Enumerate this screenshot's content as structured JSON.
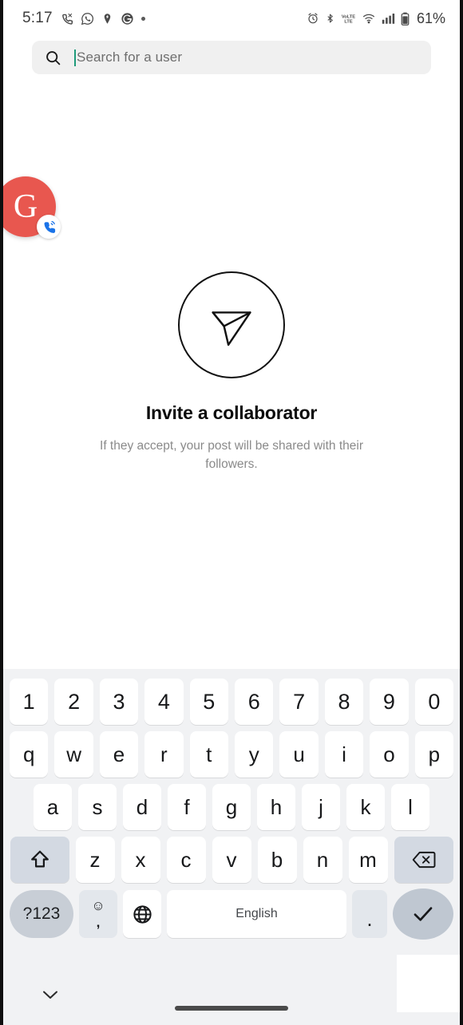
{
  "statusbar": {
    "time": "5:17",
    "left_icons": [
      "phone-call-icon",
      "whatsapp-icon",
      "location-pin-icon",
      "google-g-icon",
      "dot-icon"
    ],
    "right_icons": [
      "alarm-icon",
      "bluetooth-icon",
      "volte-icon",
      "wifi-icon",
      "signal-icon",
      "battery-icon"
    ],
    "battery_percent": "61%"
  },
  "search": {
    "placeholder": "Search for a user",
    "value": "",
    "icon": "search-icon",
    "caret_color": "#1f9b7a"
  },
  "floating_bubble": {
    "letter": "G",
    "color": "#e8574f",
    "badge_icon": "phone-call-icon"
  },
  "empty_state": {
    "icon": "send-paper-plane-icon",
    "title": "Invite a collaborator",
    "subtitle": "If they accept, your post will be shared with their followers."
  },
  "keyboard": {
    "row_numbers": [
      "1",
      "2",
      "3",
      "4",
      "5",
      "6",
      "7",
      "8",
      "9",
      "0"
    ],
    "row_top": [
      "q",
      "w",
      "e",
      "r",
      "t",
      "y",
      "u",
      "i",
      "o",
      "p"
    ],
    "row_home": [
      "a",
      "s",
      "d",
      "f",
      "g",
      "h",
      "j",
      "k",
      "l"
    ],
    "row_bottom_letters": [
      "z",
      "x",
      "c",
      "v",
      "b",
      "n",
      "m"
    ],
    "shift_key": "shift-icon",
    "backspace_key": "backspace-icon",
    "symbols_key": "?123",
    "emoji_key_top": "☺",
    "emoji_key_bottom": ",",
    "globe_key": "globe-icon",
    "space_key": "English",
    "period_key": ".",
    "enter_key": "checkmark-icon",
    "mod_key_color": "#d3d9e2",
    "background": "#f1f2f4"
  },
  "navbar": {
    "hide_keyboard_icon": "chevron-down-icon",
    "home_indicator": "home-pill"
  }
}
